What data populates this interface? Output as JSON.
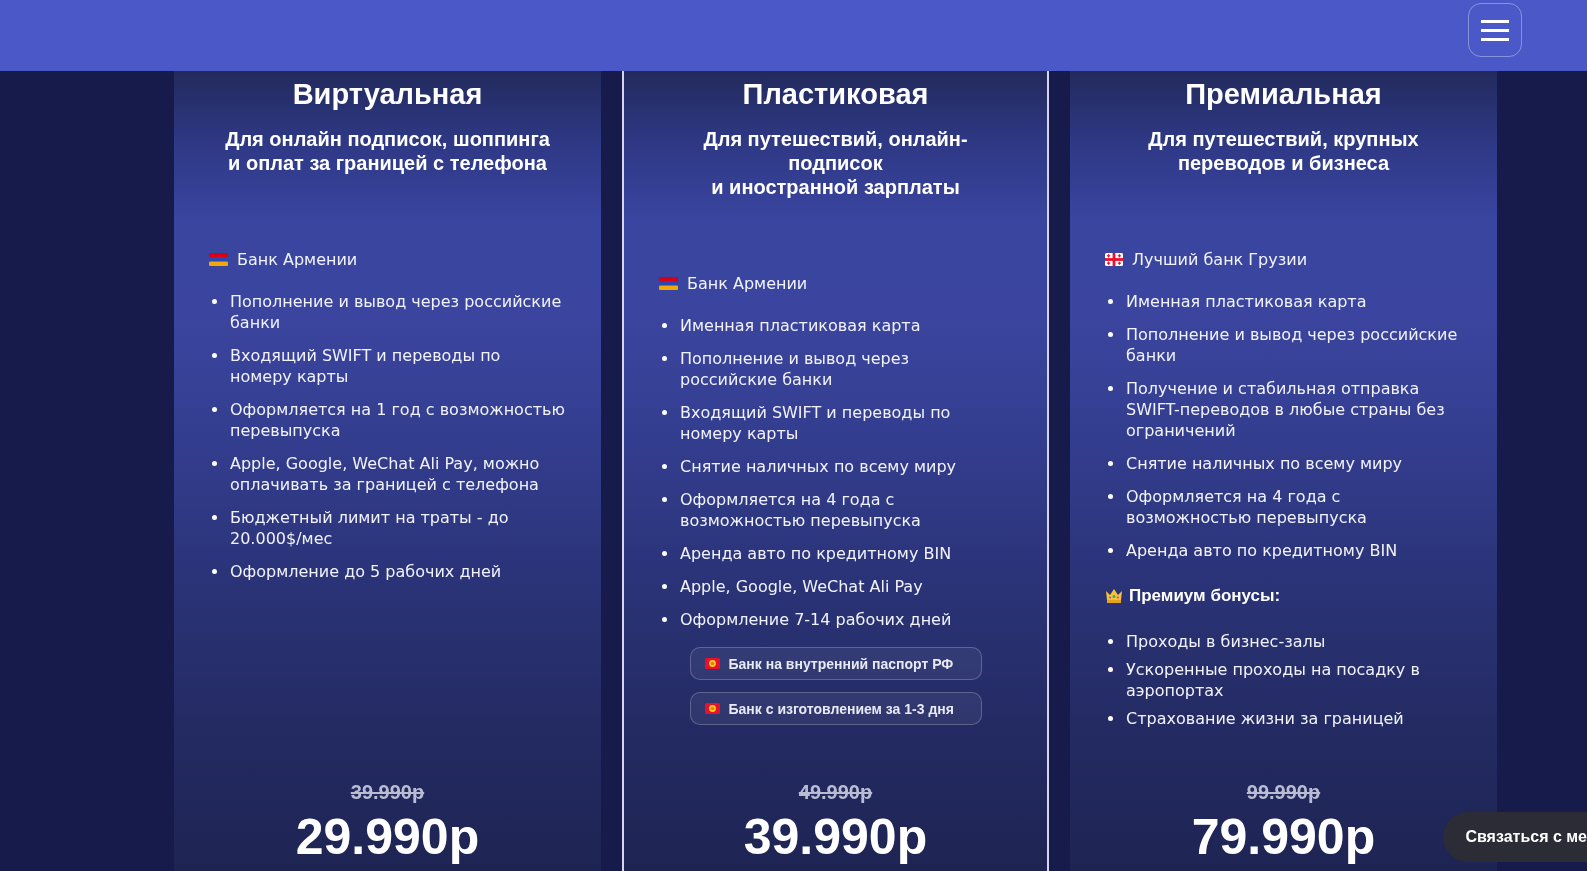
{
  "plans": [
    {
      "title": "Виртуальная",
      "subtitle": "Для онлайн подписок, шоппинга\nи оплат за границей с телефона",
      "highlighted": false,
      "bank": {
        "kind": "armenia",
        "name": "Банк Армении"
      },
      "features": [
        "Пополнение и вывод через российские банки",
        "Входящий SWIFT и переводы по номеру карты",
        "Оформляется на 1 год с возможностью перевыпуска",
        "Apple, Google, WeChat Ali Pay, можно оплачивать за границей с телефона",
        "Бюджетный лимит на траты - до 20.000$/мес",
        "Оформление до 5 рабочих дней"
      ],
      "old_price": "39.990р",
      "price": "29.990р"
    },
    {
      "title": "Пластиковая",
      "subtitle": "Для путешествий, онлайн-\nподписок\nи иностранной зарплаты",
      "highlighted": true,
      "bank": {
        "kind": "armenia",
        "name": "Банк Армении"
      },
      "features": [
        "Именная пластиковая карта",
        "Пополнение и вывод через российские банки",
        "Входящий SWIFT и переводы по номеру карты",
        "Снятие наличных по всему миру",
        "Оформляется на 4 года с возможностью перевыпуска",
        "Аренда авто по кредитному BIN",
        "Apple, Google, WeChat Ali Pay",
        "Оформление 7-14 рабочих дней"
      ],
      "badges": [
        {
          "kind": "kyrgyzstan",
          "label": "Банк на внутренний паспорт РФ"
        },
        {
          "kind": "kyrgyzstan",
          "label": "Банк с изготовлением за 1-3 дня"
        }
      ],
      "old_price": "49.990р",
      "price": "39.990р"
    },
    {
      "title": "Премиальная",
      "subtitle": "Для путешествий, крупных\nпереводов и бизнеса",
      "highlighted": false,
      "bank": {
        "kind": "georgia",
        "name": "Лучший банк Грузии"
      },
      "features": [
        "Именная пластиковая карта",
        "Пополнение и вывод через российские банки",
        "Получение и стабильная отправка SWIFT-переводов в любые страны без ограничений",
        "Снятие наличных по всему миру",
        "Оформляется на 4 года с возможностью перевыпуска",
        "Аренда авто по кредитному BIN"
      ],
      "bonuses": {
        "title": "Премиум бонусы:",
        "items": [
          "Проходы в бизнес-залы",
          "Ускоренные проходы на посадку в аэропортах",
          "Страхование жизни за границей"
        ]
      },
      "old_price": "99.990р",
      "price": "79.990р"
    }
  ],
  "contact_button": {
    "label": "Связаться с ме"
  }
}
